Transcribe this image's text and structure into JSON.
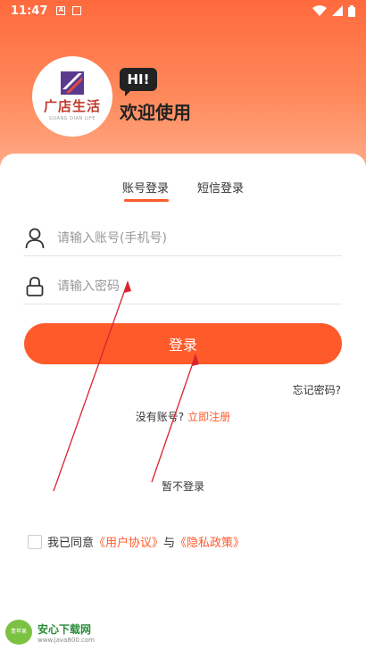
{
  "status_bar": {
    "time": "11:47",
    "icon_a_label": "A"
  },
  "logo": {
    "name_cn": "广店生活",
    "name_en": "GUANG DIAN LIFE"
  },
  "header": {
    "hi_text": "HI!",
    "welcome_text": "欢迎使用"
  },
  "tabs": [
    {
      "label": "账号登录",
      "active": true
    },
    {
      "label": "短信登录",
      "active": false
    }
  ],
  "form": {
    "account_placeholder": "请输入账号(手机号)",
    "password_placeholder": "请输入密码",
    "login_label": "登录",
    "forgot_label": "忘记密码?",
    "no_account_text": "没有账号?",
    "register_label": "立即注册",
    "skip_label": "暂不登录"
  },
  "agreement": {
    "prefix": "我已同意",
    "user_agreement": "《用户协议》",
    "and": "与",
    "privacy_policy": "《隐私政策》"
  },
  "watermark": {
    "badge": "青苹果",
    "title": "安心下载网",
    "url": "www.java800.com"
  },
  "colors": {
    "accent": "#ff5a2a",
    "header_top": "#ff6a3d",
    "annotation_arrow": "#d9232e"
  }
}
